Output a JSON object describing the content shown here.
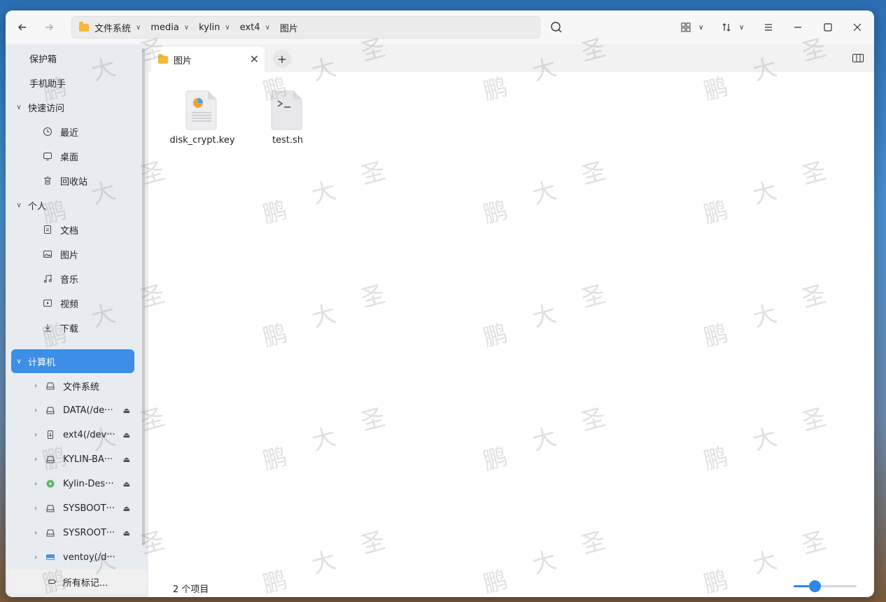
{
  "titlebar": {
    "breadcrumb": [
      "文件系统",
      "media",
      "kylin",
      "ext4",
      "图片"
    ]
  },
  "sidebar": {
    "items": [
      {
        "label": "保护箱"
      },
      {
        "label": "手机助手"
      },
      {
        "label": "快速访问"
      },
      {
        "label": "最近"
      },
      {
        "label": "桌面"
      },
      {
        "label": "回收站"
      },
      {
        "label": "个人"
      },
      {
        "label": "文档"
      },
      {
        "label": "图片"
      },
      {
        "label": "音乐"
      },
      {
        "label": "视频"
      },
      {
        "label": "下载"
      },
      {
        "label": "计算机"
      },
      {
        "label": "文件系统"
      },
      {
        "label": "DATA(/de···"
      },
      {
        "label": "ext4(/dev···"
      },
      {
        "label": "KYLIN-BA···"
      },
      {
        "label": "Kylin-Des···"
      },
      {
        "label": "SYSBOOT···"
      },
      {
        "label": "SYSROOT···"
      },
      {
        "label": "ventoy(/d···"
      }
    ],
    "tags_button": "所有标记..."
  },
  "tabs": [
    {
      "label": "图片"
    }
  ],
  "files": [
    {
      "name": "disk_crypt.key"
    },
    {
      "name": "test.sh"
    }
  ],
  "status": {
    "item_count": "2 个项目",
    "zoom_level": 0.3
  },
  "watermark": {
    "chars": [
      "鹏",
      "大",
      "圣"
    ]
  },
  "colors": {
    "accent": "#3d8ee6",
    "folder": "#f6b93b"
  }
}
